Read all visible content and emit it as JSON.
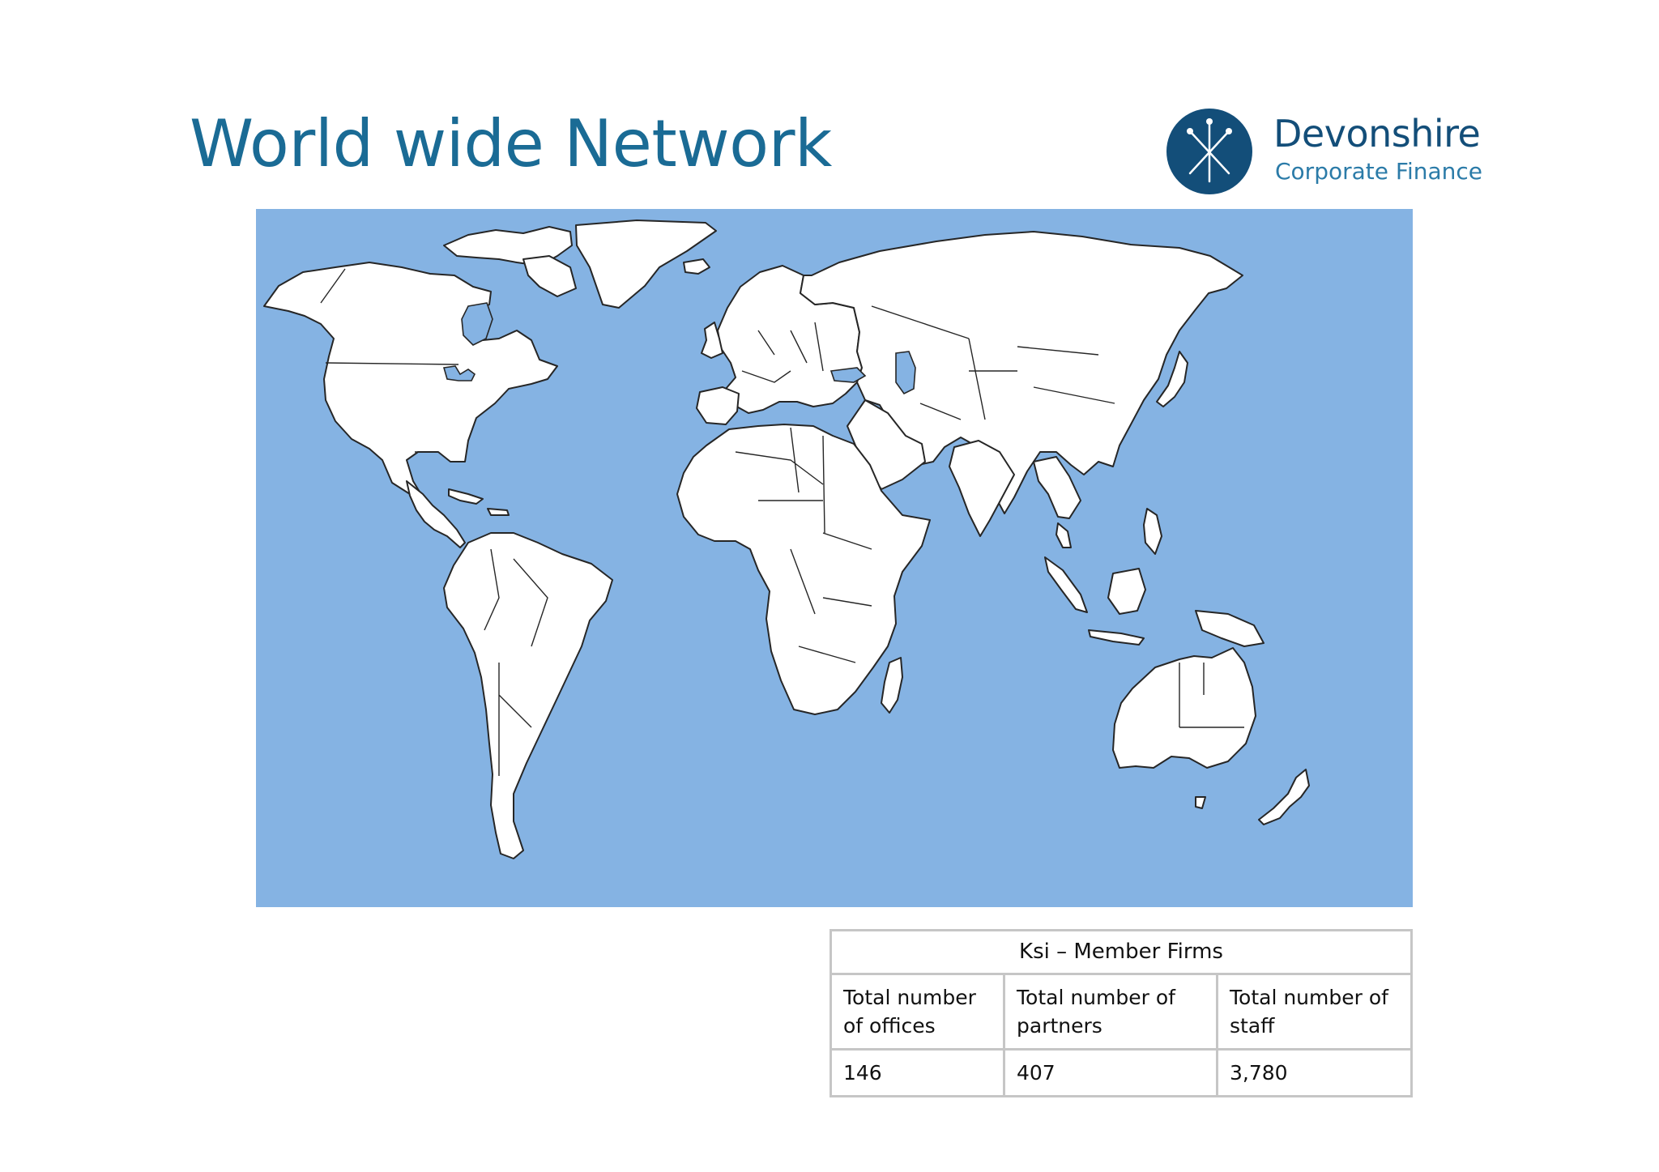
{
  "title": "World wide Network",
  "brand": {
    "name": "Devonshire",
    "subtitle": "Corporate Finance",
    "color": "#134e79"
  },
  "map": {
    "ocean_color": "#85b3e3",
    "land_color": "#ffffff",
    "border_color": "#262626"
  },
  "table": {
    "header": "Ksi – Member Firms",
    "columns": [
      "Total number of offices",
      "Total number of partners",
      "Total number of staff"
    ],
    "values": [
      "146",
      "407",
      "3,780"
    ]
  }
}
